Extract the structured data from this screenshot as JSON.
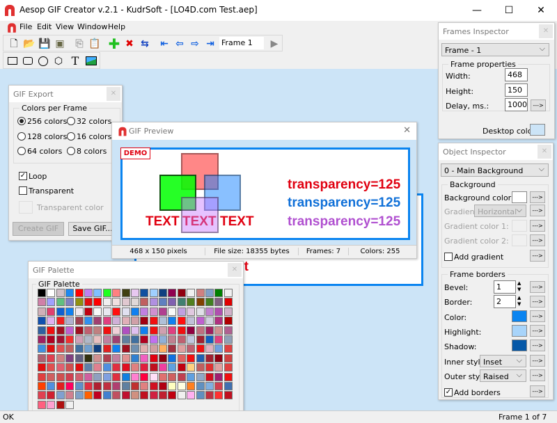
{
  "window": {
    "title": "Aesop GIF Creator v.2.1 - KudrSoft - [LO4D.com Test.aep]",
    "min": "—",
    "max": "☐",
    "close": "✕"
  },
  "menu": [
    "File",
    "Edit",
    "View",
    "Window",
    "Help"
  ],
  "toolbar": {
    "frame_field": "Frame 1"
  },
  "gif_export": {
    "title": "GIF Export",
    "group": "Colors per Frame",
    "options": [
      "256 colors",
      "32 colors",
      "128 colors",
      "16 colors",
      "64 colors",
      "8 colors"
    ],
    "selected": "256 colors",
    "loop": "Loop",
    "loop_checked": true,
    "transparent": "Transparent",
    "transparent_checked": false,
    "transparent_color": "Transparent color",
    "create": "Create GIF",
    "save": "Save GIF..."
  },
  "preview": {
    "title": "GIF Preview",
    "demo": "DEMO",
    "text": [
      "TEXT",
      "TEXT",
      "TEXT"
    ],
    "transparency": [
      "transparency=125",
      "transparency=125",
      "transparency=125"
    ],
    "colors_text": [
      "#e00010",
      "#1070d8",
      "#b050d0"
    ],
    "status": [
      "468 x 150 pixels",
      "File size: 18355 bytes",
      "Frames: 7",
      "Colors: 255"
    ]
  },
  "canvas": {
    "partial_text": "st"
  },
  "palette": {
    "title": "GIF Palette",
    "group": "GIF Palette",
    "colors": [
      "#000000",
      "#ffffff",
      "#d0c0c8",
      "#1e88f0",
      "#ff0000",
      "#c080f0",
      "#80c0ff",
      "#20ff20",
      "#ff8080",
      "#404010",
      "#e8c8f0",
      "#1050a0",
      "#a0d0ff",
      "#104080",
      "#900050",
      "#900010",
      "#f0f0f0",
      "#d08080",
      "#80a0c8",
      "#008000",
      "#f0f0f0",
      "#d080a8",
      "#a0a0ff",
      "#60c080",
      "#8080c0",
      "#909010",
      "#e01010",
      "#ff0000",
      "#f0f0f0",
      "#f0e0e0",
      "#e0c8d0",
      "#e0d8d8",
      "#c06060",
      "#b090e0",
      "#6080c0",
      "#8060b0",
      "#408070",
      "#508020",
      "#804000",
      "#408020",
      "#806080",
      "#e00000",
      "#d0b0b8",
      "#e04070",
      "#1060d0",
      "#1080f0",
      "#f0e8f0",
      "#c00010",
      "#f8f8f8",
      "#e8e8f0",
      "#ff1010",
      "#e0e0f0",
      "#1080f0",
      "#c080e0",
      "#d090d0",
      "#b04090",
      "#f8f8f8",
      "#c0a0e0",
      "#e0c8e0",
      "#e0e0e8",
      "#c080d0",
      "#b050b0",
      "#d0b0c8",
      "#1050b0",
      "#e0b0f0",
      "#f02020",
      "#b0b0d0",
      "#a04050",
      "#3090f0",
      "#a04070",
      "#e04080",
      "#d0b0d8",
      "#e0b0b8",
      "#d0a0a8",
      "#a00010",
      "#f01010",
      "#b0c0d8",
      "#1080f0",
      "#ff1010",
      "#c0c0d8",
      "#c060d0",
      "#d0d0e0",
      "#b03080",
      "#b00000",
      "#3060a0",
      "#f01010",
      "#a01020",
      "#c060d0",
      "#a01020",
      "#c06070",
      "#c08080",
      "#f01010",
      "#f0d0d8",
      "#b050c0",
      "#e0c0f0",
      "#1080f0",
      "#f01010",
      "#d0a0b0",
      "#e04080",
      "#f01010",
      "#900040",
      "#c07080",
      "#a02060",
      "#d09090",
      "#b06090",
      "#a02060",
      "#b00020",
      "#a01030",
      "#f03030",
      "#d0a0b8",
      "#b0b8c8",
      "#e8c0c0",
      "#c080a0",
      "#a04070",
      "#6080a0",
      "#4070a0",
      "#b00020",
      "#c070f0",
      "#90b0d8",
      "#c08090",
      "#c06070",
      "#c0c8e0",
      "#a02030",
      "#1060c0",
      "#e04080",
      "#90a0b8",
      "#4090e0",
      "#e01010",
      "#e05050",
      "#c06060",
      "#4070a0",
      "#70a0d0",
      "#104080",
      "#e02020",
      "#1080f0",
      "#a01020",
      "#7090b0",
      "#e0b0b0",
      "#d0a0a0",
      "#ffb060",
      "#a03040",
      "#e0a0a0",
      "#c06070",
      "#f01010",
      "#e0b0c0",
      "#70a0e0",
      "#e04040",
      "#b06070",
      "#e04050",
      "#d08080",
      "#804080",
      "#606080",
      "#303010",
      "#d09090",
      "#b04050",
      "#c080a0",
      "#e09090",
      "#3080d0",
      "#f060c0",
      "#e00010",
      "#900010",
      "#1070e0",
      "#e06060",
      "#f01010",
      "#2060b0",
      "#a02030",
      "#900010",
      "#d04040",
      "#e01010",
      "#e05050",
      "#e06070",
      "#d05050",
      "#e01010",
      "#6080a8",
      "#e08090",
      "#5090e0",
      "#e03040",
      "#e01020",
      "#e08080",
      "#e02040",
      "#c01020",
      "#f040a0",
      "#60a0e0",
      "#c00010",
      "#ffd080",
      "#c06060",
      "#e03030",
      "#e0a0a0",
      "#e04040",
      "#e04040",
      "#d06060",
      "#d05050",
      "#d04050",
      "#d06070",
      "#d060a0",
      "#90a0c0",
      "#80a0e0",
      "#e03040",
      "#1080e0",
      "#ff80d0",
      "#ff0040",
      "#ffe0f8",
      "#e07070",
      "#d06060",
      "#c04050",
      "#60a0e0",
      "#90a8c8",
      "#d01020",
      "#a02070",
      "#f01010",
      "#ff4000",
      "#5090e0",
      "#e02020",
      "#ff0060",
      "#6090c8",
      "#e03040",
      "#b02030",
      "#c03040",
      "#b04070",
      "#6080a0",
      "#c03030",
      "#e08080",
      "#d01020",
      "#b00010",
      "#ffffc0",
      "#ffffe0",
      "#ff8020",
      "#6090c0",
      "#80b0e0",
      "#d04050",
      "#4070b0",
      "#e04050",
      "#d02030",
      "#80a0d0",
      "#d08090",
      "#80a0c8",
      "#ff6000",
      "#c00020",
      "#4080d0",
      "#c05060",
      "#c01030",
      "#d09080",
      "#c01020",
      "#d02040",
      "#c02030",
      "#c00010",
      "#f0f0f0",
      "#ffb0f0",
      "#6090c0",
      "#c03040",
      "#ff3030",
      "#c01020",
      "#ff6080",
      "#ffa0d0",
      "#b01010",
      "#f0f0f0"
    ]
  },
  "frames_inspector": {
    "title": "Frames Inspector",
    "frame_select": "Frame - 1",
    "group": "Frame properties",
    "width_label": "Width:",
    "width": "468",
    "height_label": "Height:",
    "height": "150",
    "delay_label": "Delay, ms.:",
    "delay": "1000",
    "arrow": "--->",
    "desktop_color_label": "Desktop color:",
    "desktop_color": "#cce4f7"
  },
  "object_inspector": {
    "title": "Object Inspector",
    "object_select": "0 - Main Background",
    "bg_group": "Background",
    "bg_color_label": "Background color:",
    "bg_color": "#ffffff",
    "gradient_label": "Gradient:",
    "gradient": "Horizontal",
    "gc1": "Gradient color 1:",
    "gc2": "Gradient color 2:",
    "add_gradient": "Add gradient",
    "add_gradient_checked": false,
    "fb_group": "Frame borders",
    "bevel_label": "Bevel:",
    "bevel": "1",
    "border_label": "Border:",
    "border": "2",
    "color_label": "Color:",
    "color": "#0a84f0",
    "highlight_label": "Highlight:",
    "highlight": "#a8d4fa",
    "shadow_label": "Shadow:",
    "shadow": "#0558a8",
    "inner_label": "Inner style:",
    "inner": "Inset",
    "outer_label": "Outer style:",
    "outer": "Raised",
    "add_borders": "Add borders",
    "add_borders_checked": true,
    "arrow": "--->"
  },
  "statusbar": {
    "left": "OK",
    "right": "Frame 1 of 7"
  }
}
